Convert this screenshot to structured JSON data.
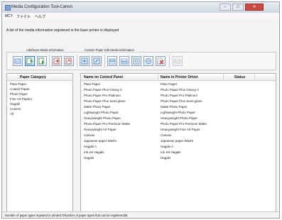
{
  "window": {
    "title": "Media Configuration Tool-Canon",
    "controls": {
      "minimize": "–",
      "maximize": "□",
      "close": "✕"
    }
  },
  "menu": [
    "MCT",
    "ファイル",
    "ヘルプ"
  ],
  "info_text": "A list of the media information registered in the base printer is displayed",
  "toolbar": {
    "groups": [
      "Add/Save Media Information",
      "Custom Paper",
      "Edit Media Information"
    ],
    "icons": [
      "media-list-icon",
      "add-media-icon",
      "save-media-icon",
      "export-icon",
      "print-icon",
      "custom-paper-add-icon",
      "custom-paper-edit-icon",
      "move-up-icon",
      "move-down-icon",
      "settings-icon",
      "edit-properties-icon",
      "delete-icon",
      "printer-icon"
    ],
    "colors": {
      "accent": "#2a74c6",
      "delete": "#d13b2f"
    }
  },
  "category_panel": {
    "header": "Paper Category",
    "items": [
      "Plain Paper",
      "Coated Paper",
      "Photo Paper",
      "Fine Art Papers",
      "Hagaki",
      "Custom",
      "All"
    ]
  },
  "media_table": {
    "columns": [
      "Name on Control Panel",
      "Name in Printer Driver",
      "Status"
    ],
    "rows": [
      [
        "Plain Paper",
        "Plain Paper",
        ""
      ],
      [
        "Photo Paper Plus Glossy II",
        "Photo Paper Plus Glossy II",
        ""
      ],
      [
        "Photo Paper Pro Platinum",
        "Photo Paper Pro Platinum",
        ""
      ],
      [
        "Photo Paper Plus Semi-gloss",
        "Photo Paper Plus Semi-gloss",
        ""
      ],
      [
        "Matte Photo Paper",
        "Matte Photo Paper",
        ""
      ],
      [
        "Lightweight Photo Paper",
        "Lightweight Photo Paper",
        ""
      ],
      [
        "Heavyweight Photo Paper",
        "Heavyweight Photo Paper",
        ""
      ],
      [
        "Photo Paper Pro Premium Matte",
        "Photo Paper Pro Premium Matte",
        ""
      ],
      [
        "Heavyweight Art Paper",
        "Heavyweight Fine Art Paper",
        ""
      ],
      [
        "Canvas",
        "Canvas",
        ""
      ],
      [
        "Japanese paper Washi",
        "Japanese paper Washi",
        ""
      ],
      [
        "Hagaki A",
        "Hagaki A",
        ""
      ],
      [
        "Ink Jet Hagaki",
        "Ink Jet Hagaki",
        ""
      ],
      [
        "Hagaki",
        "Hagaki",
        ""
      ]
    ]
  },
  "statusbar": "Number of paper types registerd in printer17/Number of paper types that can be registered28"
}
